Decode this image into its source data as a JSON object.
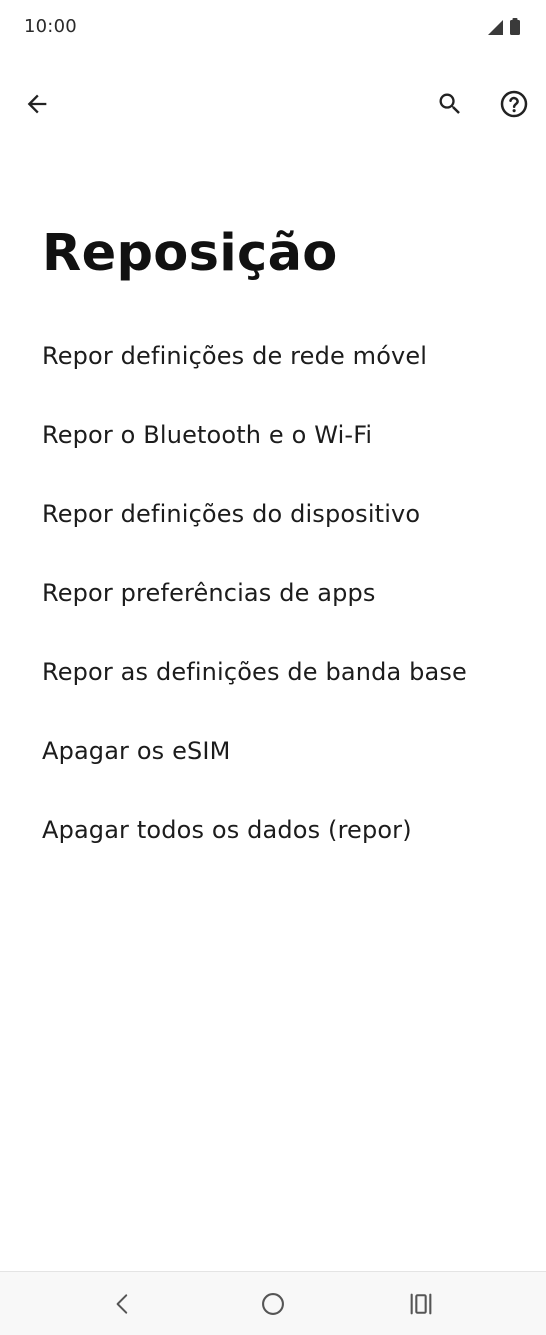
{
  "status_bar": {
    "time": "10:00",
    "icons": [
      "signal-icon",
      "battery-icon"
    ]
  },
  "app_bar": {
    "icons": [
      "back-arrow-icon",
      "search-icon",
      "help-icon"
    ]
  },
  "page": {
    "title": "Reposição"
  },
  "menu": {
    "items": [
      {
        "label": "Repor definições de rede móvel"
      },
      {
        "label": "Repor o Bluetooth e o Wi-Fi"
      },
      {
        "label": "Repor definições do dispositivo"
      },
      {
        "label": "Repor preferências de apps"
      },
      {
        "label": "Repor as definições de banda base"
      },
      {
        "label": "Apagar os eSIM"
      },
      {
        "label": "Apagar todos os dados (repor)"
      }
    ]
  },
  "nav_bar": {
    "icons": [
      "nav-back-icon",
      "nav-home-icon",
      "nav-recents-icon"
    ]
  },
  "colors": {
    "background": "#ffffff",
    "text": "#1c1c1c",
    "icon": "#222222",
    "nav_background": "#f8f8f8"
  }
}
